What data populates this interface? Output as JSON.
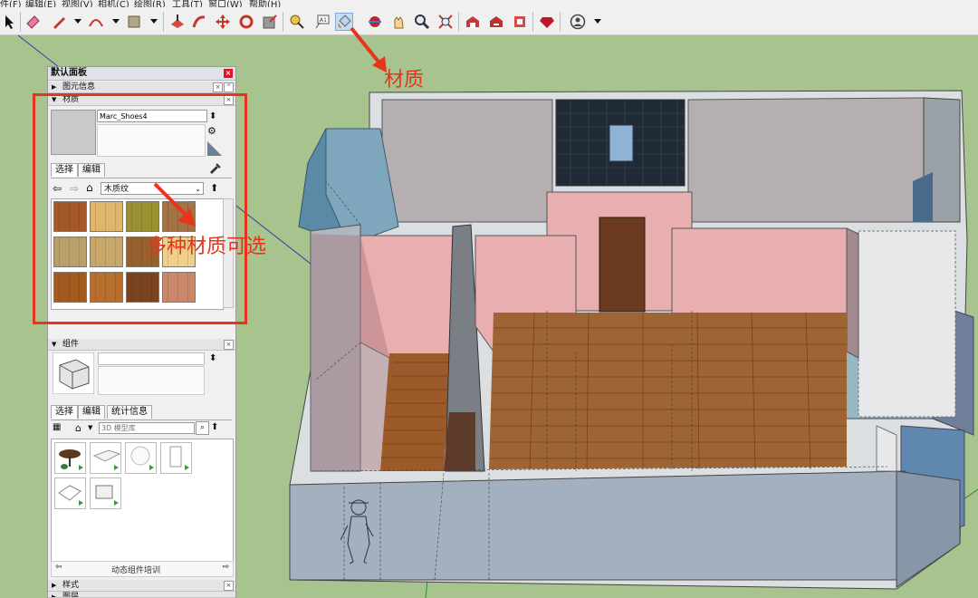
{
  "menubar": {
    "items": [
      "件(F)",
      "编辑(E)",
      "视图(V)",
      "相机(C)",
      "绘图(R)",
      "工具(T)",
      "窗口(W)",
      "帮助(H)"
    ]
  },
  "toolbar": {
    "selected_tool": "paint-bucket-icon"
  },
  "panel": {
    "title": "默认面板",
    "entity_info_label": "图元信息",
    "materials": {
      "label": "材质",
      "name_value": "Marc_Shoes4",
      "tab_select": "选择",
      "tab_edit": "编辑",
      "library_value": "木质纹",
      "swatch_colors": [
        "#a5582a",
        "#e0b56c",
        "#9a9232",
        "#a37245",
        "#b9a06a",
        "#c8a86a",
        "#96612e",
        "#efd08a",
        "#a35a1f",
        "#b86e2c",
        "#7a4421",
        "#c9886a"
      ]
    },
    "components": {
      "label": "组件",
      "tab_select": "选择",
      "tab_edit": "编辑",
      "tab_stats": "统计信息",
      "search_placeholder": "3D 模型库",
      "dynamic_training": "动态组件培训"
    },
    "styles_label": "样式",
    "layers_label": "图层"
  },
  "annotations": {
    "material_label": "材质",
    "materials_choice": "多种材质可选"
  },
  "colors": {
    "highlight_red": "#e8341c",
    "grass": "#a7c48f",
    "pink_wall": "#e9aeb0",
    "blue_wall": "#8fb6c9"
  }
}
